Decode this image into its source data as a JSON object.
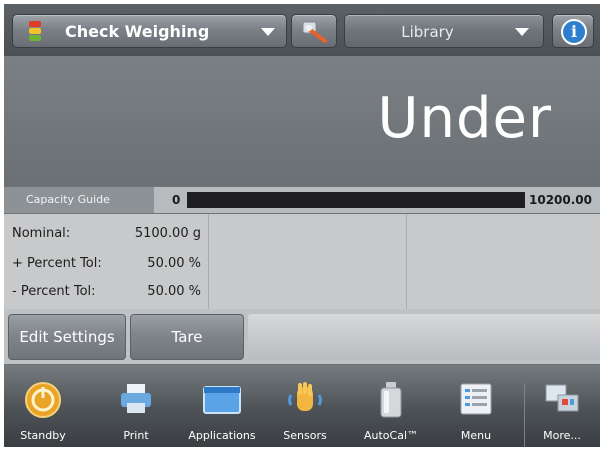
{
  "header": {
    "app_name": "Check Weighing",
    "library_label": "Library",
    "app_icon": "check-weighing-traffic-light-icon",
    "tools_icon": "wrench-icon",
    "info_icon": "info-icon"
  },
  "display": {
    "reading": "Under"
  },
  "capacity_guide": {
    "label": "Capacity Guide",
    "min": "0",
    "max": "10200.00",
    "fill_fraction": 0.0
  },
  "info": {
    "rows": [
      {
        "key": "Nominal:",
        "value": "5100.00 g"
      },
      {
        "key": "+ Percent Tol:",
        "value": "50.00 %"
      },
      {
        "key": "- Percent Tol:",
        "value": "50.00 %"
      }
    ]
  },
  "actions": {
    "edit_settings": "Edit Settings",
    "tare": "Tare"
  },
  "nav": {
    "items": [
      {
        "label": "Standby",
        "icon": "standby-icon"
      },
      {
        "label": "Print",
        "icon": "printer-icon"
      },
      {
        "label": "Applications",
        "icon": "applications-icon"
      },
      {
        "label": "Sensors",
        "icon": "hand-sensor-icon"
      },
      {
        "label": "AutoCal™",
        "icon": "calibration-weight-icon"
      },
      {
        "label": "Menu",
        "icon": "menu-list-icon"
      },
      {
        "label": "More...",
        "icon": "more-icon"
      }
    ]
  },
  "colors": {
    "background": "#6f7377",
    "reading_text": "#ffffff",
    "info_icon": "#2f7fd0"
  }
}
